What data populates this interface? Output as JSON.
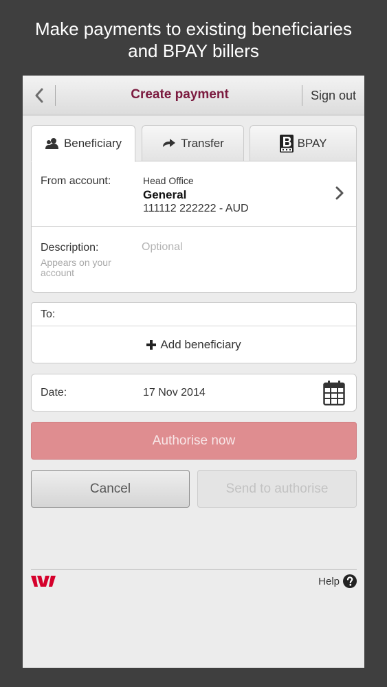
{
  "promo": {
    "line1": "Make payments to existing beneficiaries",
    "line2": "and BPAY billers"
  },
  "header": {
    "title": "Create payment",
    "sign_out": "Sign out",
    "back_icon": "chevron-left-icon"
  },
  "tabs": [
    {
      "label": "Beneficiary",
      "icon": "people-icon",
      "active": true
    },
    {
      "label": "Transfer",
      "icon": "transfer-arrow-icon",
      "active": false
    },
    {
      "label": "BPAY",
      "icon": "bpay-logo-icon",
      "active": false
    }
  ],
  "from_account": {
    "label": "From account:",
    "group": "Head Office",
    "name": "General",
    "number": "111112 222222 - AUD"
  },
  "description": {
    "label": "Description:",
    "hint": "Appears on your account",
    "placeholder": "Optional",
    "value": ""
  },
  "to": {
    "label": "To:",
    "add_label": "Add beneficiary"
  },
  "date": {
    "label": "Date:",
    "value": "17 Nov 2014"
  },
  "actions": {
    "authorise_now": "Authorise now",
    "cancel": "Cancel",
    "send_to_authorise": "Send to authorise"
  },
  "footer": {
    "help": "Help"
  },
  "colors": {
    "accent": "#7b1a3f",
    "brand_red": "#d5002b",
    "authorise_bg": "#df8d90"
  }
}
